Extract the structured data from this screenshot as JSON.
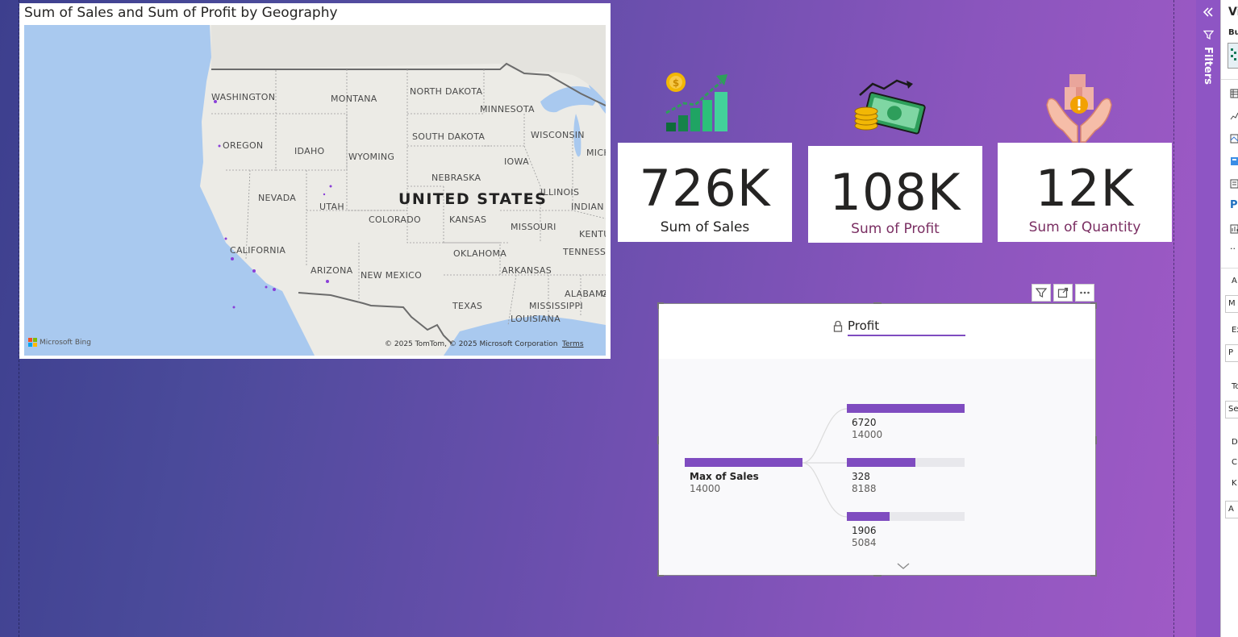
{
  "map": {
    "title": "Sum of Sales and Sum of Profit by Geography",
    "country_label": "UNITED STATES",
    "states": [
      {
        "name": "WASHINGTON"
      },
      {
        "name": "MONTANA"
      },
      {
        "name": "NORTH DAKOTA"
      },
      {
        "name": "MINNESOTA"
      },
      {
        "name": "OREGON"
      },
      {
        "name": "IDAHO"
      },
      {
        "name": "WYOMING"
      },
      {
        "name": "SOUTH DAKOTA"
      },
      {
        "name": "WISCONSIN"
      },
      {
        "name": "MICH"
      },
      {
        "name": "IOWA"
      },
      {
        "name": "NEBRASKA"
      },
      {
        "name": "NEVADA"
      },
      {
        "name": "UTAH"
      },
      {
        "name": "ILLINOIS"
      },
      {
        "name": "INDIAN"
      },
      {
        "name": "COLORADO"
      },
      {
        "name": "KANSAS"
      },
      {
        "name": "MISSOURI"
      },
      {
        "name": "KENTU"
      },
      {
        "name": "CALIFORNIA"
      },
      {
        "name": "OKLAHOMA"
      },
      {
        "name": "TENNESSE"
      },
      {
        "name": "ARIZONA"
      },
      {
        "name": "NEW MEXICO"
      },
      {
        "name": "ARKANSAS"
      },
      {
        "name": "ALABAMA"
      },
      {
        "name": "TEXAS"
      },
      {
        "name": "MISSISSIPPI"
      },
      {
        "name": "G"
      },
      {
        "name": "LOUISIANA"
      }
    ],
    "attribution": "© 2025 TomTom, © 2025 Microsoft Corporation",
    "terms": "Terms",
    "provider": "Microsoft Bing",
    "colors": {
      "water": "#a9c9ef",
      "land": "#ecebe6",
      "border": "#6b6b6b",
      "data_point": "#8a3fd8"
    }
  },
  "kpis": [
    {
      "value": "726K",
      "label": "Sum of Sales",
      "label_color": "#252423",
      "icon": "money-growth-chart-icon"
    },
    {
      "value": "108K",
      "label": "Sum of Profit",
      "label_color": "#7a2e62",
      "icon": "cash-coins-icon"
    },
    {
      "value": "12K",
      "label": "Sum of Quantity",
      "label_color": "#7a2e62",
      "icon": "hands-box-icon"
    }
  ],
  "decomposition_tree": {
    "header_label": "Profit",
    "accent": "#7f4cc0",
    "root": {
      "name": "Max of Sales",
      "value": "14000",
      "fill": 1.0
    },
    "children": [
      {
        "value": "6720",
        "sub": "14000",
        "fill": 1.0
      },
      {
        "value": "328",
        "sub": "8188",
        "fill": 0.58
      },
      {
        "value": "1906",
        "sub": "5084",
        "fill": 0.36
      }
    ]
  },
  "panes": {
    "filters_label": "Filters",
    "viz": {
      "header": "Vi",
      "build": "Bu",
      "section_items": [
        "A",
        "M",
        "Ex",
        "P",
        "To",
        "Se",
        "D",
        "C",
        "K",
        "A"
      ],
      "p_label": "P",
      "more": "··"
    }
  }
}
